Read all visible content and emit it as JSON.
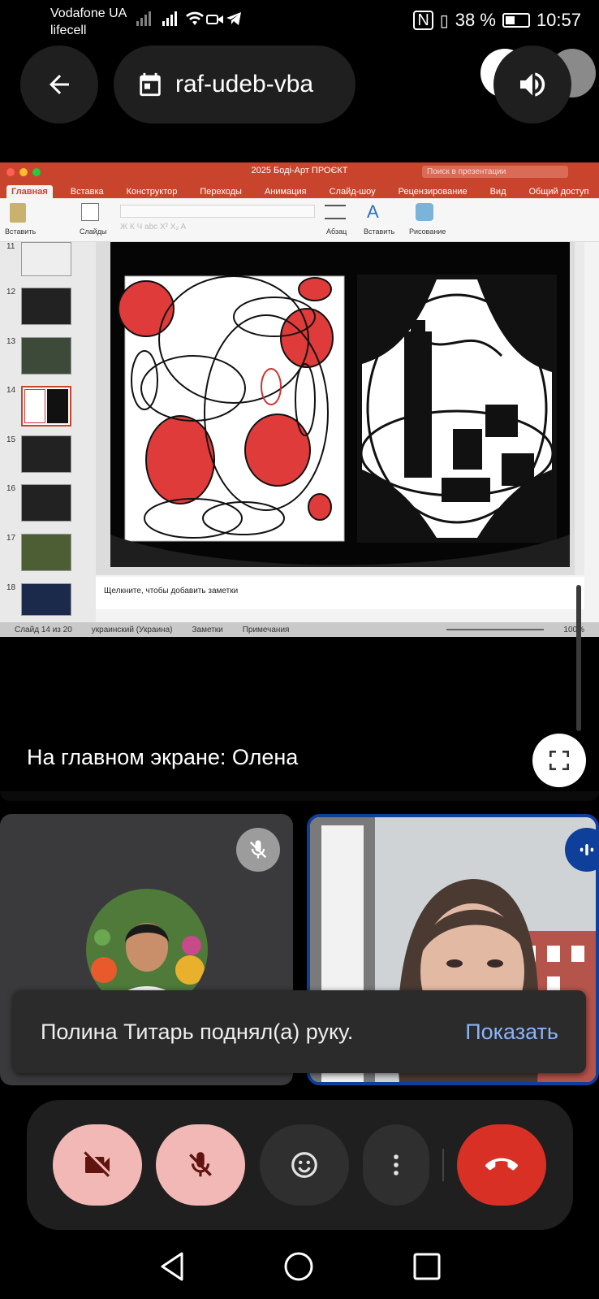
{
  "status_bar": {
    "carrier_1": "Vodafone UA",
    "carrier_2": "lifecell",
    "battery_percent": "38 %",
    "time": "10:57"
  },
  "header": {
    "back_icon": "arrow-back-icon",
    "meeting_code": "raf-udeb-vba",
    "calendar_icon": "calendar-icon",
    "speaker_icon": "volume-up-icon"
  },
  "presentation": {
    "window_title": "2025 Боді-Арт ПРОЄКТ",
    "search_placeholder": "Поиск в презентации",
    "tabs": [
      "Главная",
      "Вставка",
      "Конструктор",
      "Переходы",
      "Анимация",
      "Слайд-шоу",
      "Рецензирование",
      "Вид"
    ],
    "share_label": "Общий доступ",
    "ribbon": {
      "paste": "Вставить",
      "slides": "Слайды",
      "paragraph": "Абзац",
      "insert": "Вставить",
      "drawing": "Рисование"
    },
    "slide_numbers": [
      "11",
      "12",
      "13",
      "14",
      "15",
      "16",
      "17",
      "18"
    ],
    "notes_placeholder": "Щелкните, чтобы добавить заметки",
    "status": {
      "slide_info": "Слайд 14 из 20",
      "language": "украинский (Украина)",
      "notes": "Заметки",
      "comments": "Примечания",
      "zoom": "100%"
    }
  },
  "presenter_label": "На главном экране: Олена",
  "participants": {
    "left_tile_state": "mic-off",
    "right_tile_state": "speaking"
  },
  "snackbar": {
    "message": "Полина Титарь поднял(а) руку.",
    "action": "Показать"
  },
  "controls": {
    "camera": "videocam-off-icon",
    "mic": "mic-off-icon",
    "reactions": "emoji-icon",
    "more": "more-vert-icon",
    "hangup": "call-end-icon"
  },
  "colors": {
    "accent_link": "#8ab4f8",
    "hangup": "#d93025",
    "muted_button": "#f2b8b5",
    "speaking_border": "#0e3f9a",
    "ppt_red": "#c8442d"
  }
}
